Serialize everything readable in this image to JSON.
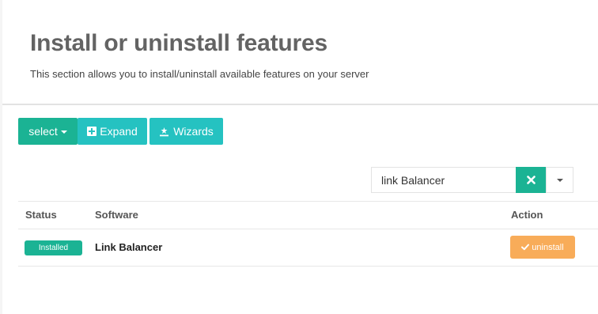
{
  "header": {
    "title": "Install or uninstall features",
    "subtitle": "This section allows you to install/uninstall available features on your server"
  },
  "toolbar": {
    "select_label": "select",
    "expand_label": "Expand",
    "wizards_label": "Wizards"
  },
  "search": {
    "value": "link Balancer"
  },
  "table": {
    "columns": [
      "Status",
      "Software",
      "Action"
    ],
    "rows": [
      {
        "status": "Installed",
        "software": "Link Balancer",
        "action": "uninstall"
      }
    ]
  },
  "colors": {
    "primary": "#1bb394",
    "info": "#25c2c1",
    "warning": "#f8ac59"
  },
  "icons": {
    "select": "caret-down-icon",
    "expand": "plus-square-icon",
    "wizards": "magic-wand-icon",
    "clear": "close-icon",
    "dropdown": "caret-down-icon",
    "uninstall": "check-icon"
  }
}
